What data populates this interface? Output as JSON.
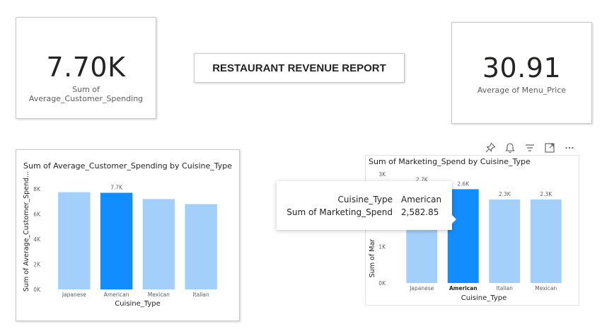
{
  "report_title": "RESTAURANT REVENUE REPORT",
  "kpi_left": {
    "value": "7.70K",
    "label": "Sum of Average_Customer_Spending"
  },
  "kpi_right": {
    "value": "30.91",
    "label": "Average of Menu_Price"
  },
  "colors": {
    "bar": "#a3cffb",
    "bar_highlight": "#118dff",
    "axis_text": "#605e5c",
    "grid": "#e6e6e6"
  },
  "visual_toolbar": [
    "pin-icon",
    "bell-icon",
    "filter-icon",
    "focus-mode-icon",
    "more-options-icon"
  ],
  "tooltip": {
    "rows": [
      {
        "key": "Cuisine_Type",
        "value": "American"
      },
      {
        "key": "Sum of Marketing_Spend",
        "value": "2,582.85"
      }
    ]
  },
  "chart_data": [
    {
      "type": "bar",
      "title": "Sum of Average_Customer_Spending by Cuisine_Type",
      "xlabel": "Cuisine_Type",
      "ylabel": "Sum of Average_Customer_Spend...",
      "categories": [
        "Japanese",
        "American",
        "Mexican",
        "Italian"
      ],
      "values": [
        7750,
        7700,
        7200,
        6800
      ],
      "data_labels": [
        "",
        "7.7K",
        "",
        ""
      ],
      "highlight_index": 1,
      "yticks": [
        "0K",
        "2K",
        "4K",
        "6K",
        "8K"
      ],
      "ylim": [
        0,
        8800
      ],
      "grid": false
    },
    {
      "type": "bar",
      "title": "Sum of Marketing_Spend by Cuisine_Type",
      "xlabel": "Cuisine_Type",
      "ylabel": "Sum of Mar",
      "categories": [
        "Japanese",
        "American",
        "Italian",
        "Mexican"
      ],
      "values": [
        2700,
        2582.85,
        2300,
        2300
      ],
      "data_labels": [
        "2.7K",
        "2.6K",
        "2.3K",
        "2.3K"
      ],
      "highlight_index": 1,
      "bold_category_index": 1,
      "yticks": [
        "0K",
        "1K",
        "2K",
        "3K"
      ],
      "ylim": [
        0,
        3000
      ],
      "grid": false
    }
  ]
}
